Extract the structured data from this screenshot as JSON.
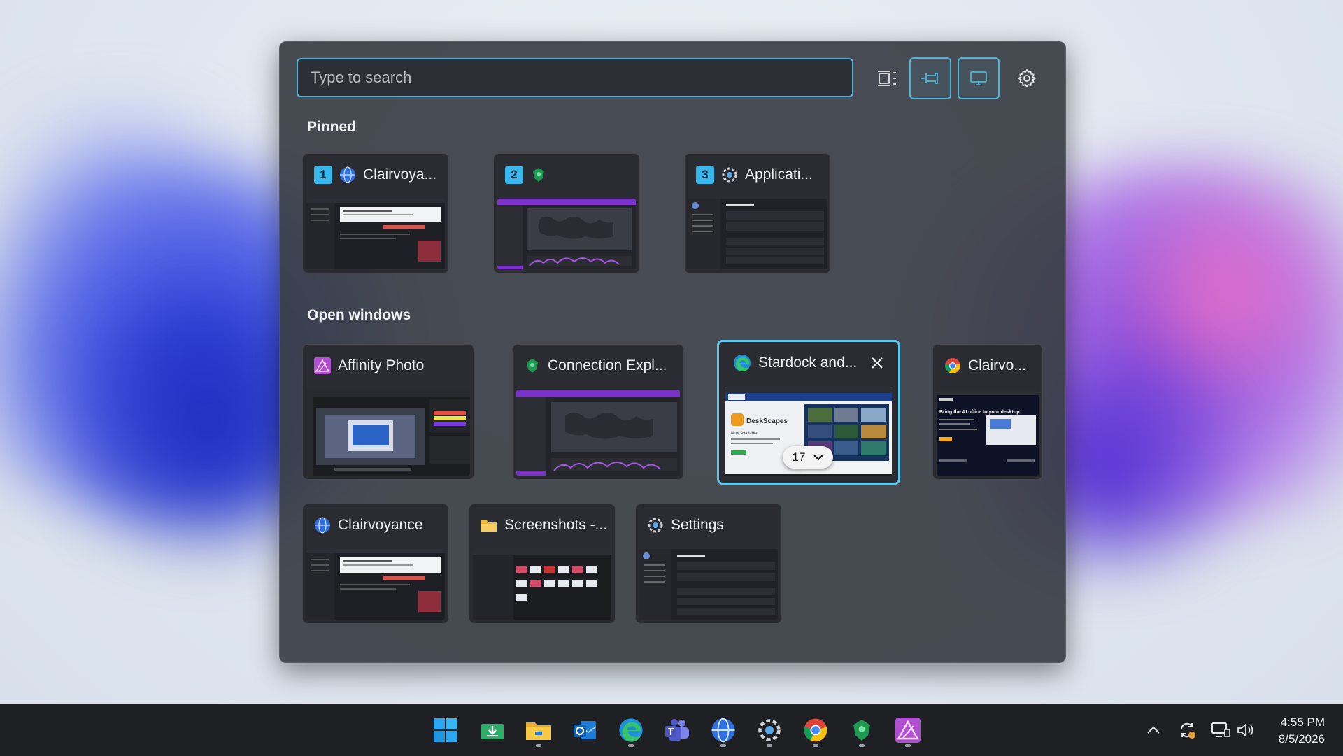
{
  "search": {
    "placeholder": "Type to search",
    "value": ""
  },
  "sections": {
    "pinned": "Pinned",
    "open_windows": "Open windows"
  },
  "pinned": [
    {
      "number": "1",
      "title": "Clairvoya...",
      "icon": "globe-icon"
    },
    {
      "number": "2",
      "title": "",
      "icon": "connection-explorer-icon"
    },
    {
      "number": "3",
      "title": "Applicati...",
      "icon": "gear-icon"
    }
  ],
  "open_windows": [
    {
      "title": "Affinity Photo",
      "icon": "affinity-photo-icon"
    },
    {
      "title": "Connection Expl...",
      "icon": "connection-explorer-icon"
    },
    {
      "title": "Stardock and...",
      "icon": "edge-icon",
      "selected": true,
      "tab_count": "17"
    },
    {
      "title": "Clairvo...",
      "icon": "chrome-icon"
    },
    {
      "title": "Clairvoyance",
      "icon": "globe-icon"
    },
    {
      "title": "Screenshots -...",
      "icon": "folder-icon"
    },
    {
      "title": "Settings",
      "icon": "gear-icon"
    }
  ],
  "thumbnail_text": {
    "deskscapes": "DeskScapes",
    "now_available": "Now Available",
    "bring": "Bring the AI office to your desktop"
  },
  "clock": {
    "time": "4:55 PM",
    "date": "8/5/2026"
  },
  "colors": {
    "accent": "#4fb4d9",
    "panel": "#3a3e46",
    "badge": "#39b6ea",
    "taskbar": "#1f2024"
  }
}
